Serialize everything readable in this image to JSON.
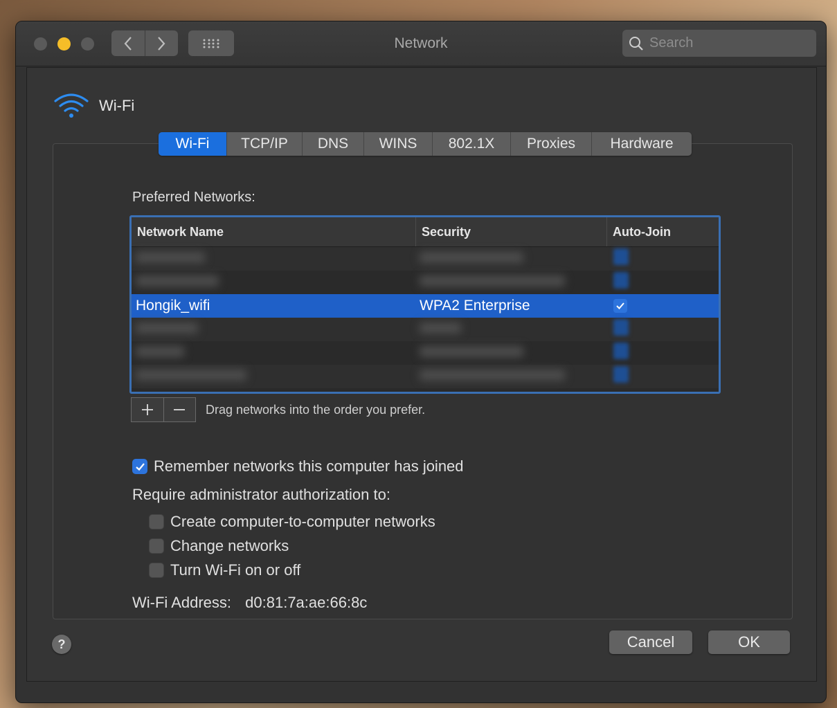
{
  "window": {
    "title": "Network",
    "search_placeholder": "Search"
  },
  "header": {
    "label": "Wi-Fi",
    "icon": "wifi-icon",
    "accent_color": "#2d8cf0"
  },
  "tabs": [
    {
      "label": "Wi-Fi",
      "active": true
    },
    {
      "label": "TCP/IP",
      "active": false
    },
    {
      "label": "DNS",
      "active": false
    },
    {
      "label": "WINS",
      "active": false
    },
    {
      "label": "802.1X",
      "active": false
    },
    {
      "label": "Proxies",
      "active": false
    },
    {
      "label": "Hardware",
      "active": false
    }
  ],
  "preferred": {
    "label": "Preferred Networks:",
    "columns": [
      "Network Name",
      "Security",
      "Auto-Join"
    ],
    "selected_row": {
      "name": "Hongik_wifi",
      "security": "WPA2 Enterprise",
      "auto_join": true
    },
    "drag_hint": "Drag networks into the order you prefer."
  },
  "options": {
    "remember": {
      "label": "Remember networks this computer has joined",
      "checked": true
    },
    "require_label": "Require administrator authorization to:",
    "create": {
      "label": "Create computer-to-computer networks",
      "checked": false
    },
    "change": {
      "label": "Change networks",
      "checked": false
    },
    "toggle": {
      "label": "Turn Wi-Fi on or off",
      "checked": false
    }
  },
  "address": {
    "label": "Wi-Fi Address:",
    "value": "d0:81:7a:ae:66:8c"
  },
  "buttons": {
    "help": "?",
    "cancel": "Cancel",
    "ok": "OK"
  },
  "colors": {
    "selection": "#1f60c8",
    "tab_active": "#1b6fde",
    "traffic_yellow": "#f5bd28"
  }
}
